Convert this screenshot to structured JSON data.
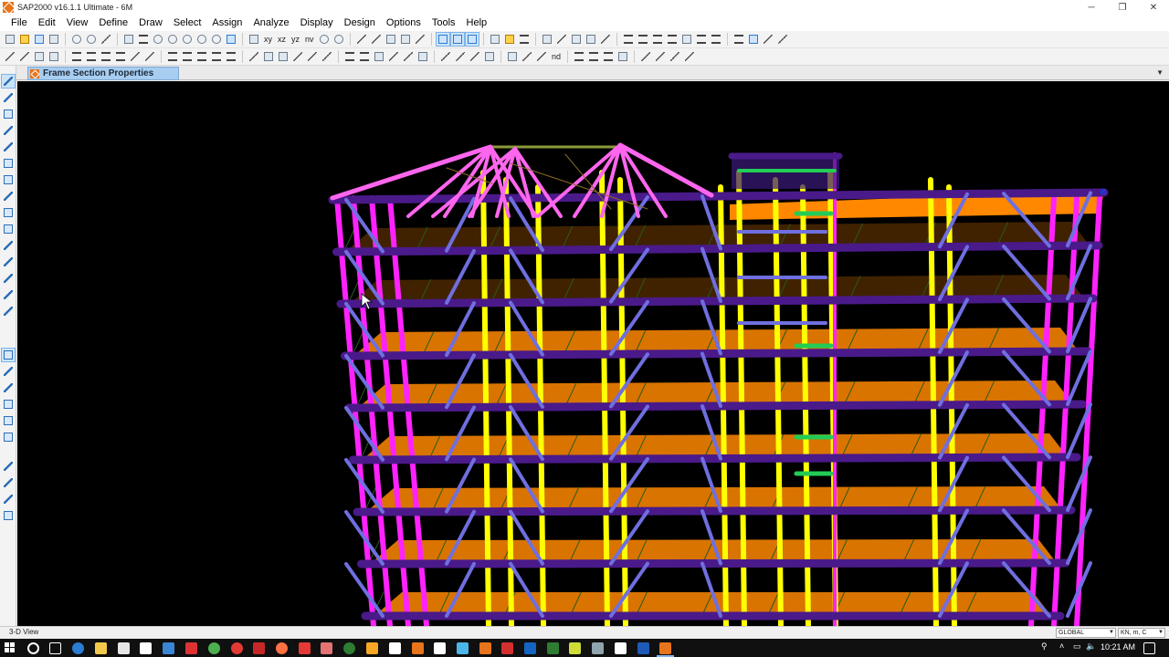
{
  "window": {
    "title": "SAP2000 v16.1.1 Ultimate  - 6M",
    "minimize_glyph": "─",
    "maximize_glyph": "❐",
    "close_glyph": "✕"
  },
  "menu": [
    "File",
    "Edit",
    "View",
    "Define",
    "Draw",
    "Select",
    "Assign",
    "Analyze",
    "Display",
    "Design",
    "Options",
    "Tools",
    "Help"
  ],
  "toolbar": {
    "view_xy": "xy",
    "view_xz": "xz",
    "view_yz": "yz",
    "view_nv": "nv",
    "label_nd": "nd"
  },
  "window_tab": {
    "label": "Frame Section Properties",
    "dropdown_glyph": "▼"
  },
  "status": {
    "view_name": "3-D View",
    "coord_system": "GLOBAL",
    "units": "KN, m, C",
    "combo_arrow": "▼"
  },
  "taskbar": {
    "clock": "10:21 AM",
    "tray_glyphs": [
      "⚲",
      "˄",
      "▭",
      "🔈"
    ]
  },
  "colors": {
    "columns_perimeter": "#ff22ff",
    "columns_core": "#ffff00",
    "braces": "#6f6fe0",
    "beams": "#4a1a8a",
    "slabs": "#ff8800",
    "roof_truss": "#ff66ee",
    "highlight_green": "#22cc55",
    "app_orange": "#e8741c"
  }
}
